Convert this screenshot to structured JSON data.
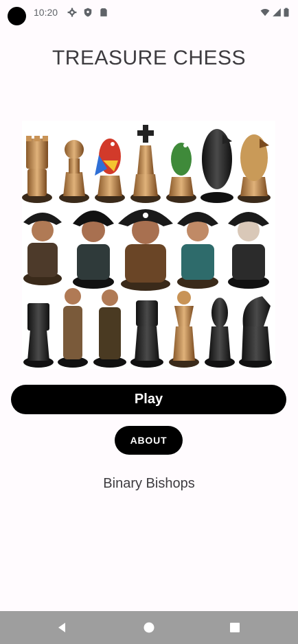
{
  "status_bar": {
    "time": "10:20",
    "left_icons": [
      "settings-icon",
      "shield-icon",
      "sim-card-icon"
    ],
    "right_icons": [
      "wifi-icon",
      "cell-signal-icon",
      "battery-icon"
    ]
  },
  "app": {
    "title": "TREASURE CHESS",
    "hero_image": "pirate-chess-pieces-illustration",
    "play_label": "Play",
    "about_label": "ABOUT",
    "subtitle": "Binary Bishops"
  },
  "nav_bar": {
    "buttons": [
      "back-icon",
      "home-icon",
      "recents-icon"
    ]
  },
  "colors": {
    "background": "#fffbfe",
    "button": "#000000",
    "button_text": "#ffffff",
    "nav_bar": "#9e9e9e",
    "text": "#3d3b3f"
  }
}
